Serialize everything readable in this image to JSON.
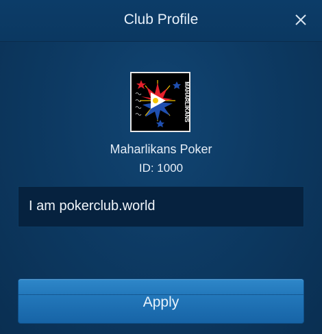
{
  "dialog": {
    "title": "Club Profile",
    "close_icon": "close-icon"
  },
  "club": {
    "name": "Maharlikans Poker",
    "id_text": "ID: 1000",
    "description": "I am pokerclub.world",
    "logo_text": "MAHARLIKANS"
  },
  "actions": {
    "apply_label": "Apply"
  },
  "colors": {
    "background": "#0d3a63",
    "header": "#0c3c68",
    "description_box": "#06223f",
    "button": "#2378bb",
    "text": "#e6eef7"
  }
}
